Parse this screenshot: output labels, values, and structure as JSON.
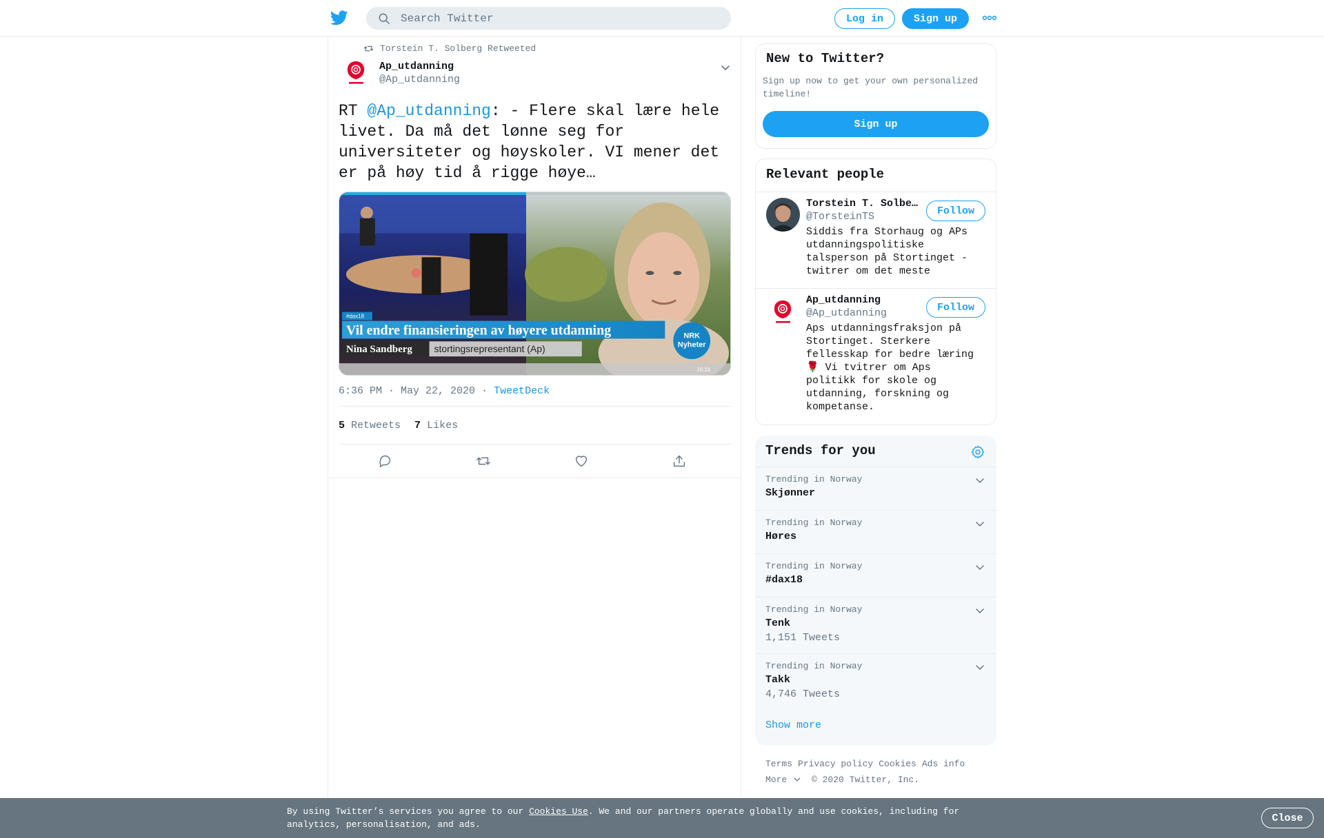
{
  "header": {
    "search_placeholder": "Search Twitter",
    "login_label": "Log in",
    "signup_label": "Sign up"
  },
  "tweet": {
    "retweeted_by": "Torstein T. Solberg Retweeted",
    "author_name": "Ap_utdanning",
    "author_handle": "@Ap_utdanning",
    "text_prefix": "RT ",
    "text_mention": "@Ap_utdanning",
    "text_body": ": - Flere skal lære hele livet. Da må det lønne seg for universiteter og høyskoler. VI mener det er på høy tid å rigge høye…",
    "media": {
      "tag": "#dax18",
      "headline": "Vil endre finansieringen av høyere utdanning",
      "person_name": "Nina Sandberg",
      "person_role": "stortingsrepresentant (Ap)",
      "channel_line1": "NRK",
      "channel_line2": "Nyheter",
      "clock": "16:16"
    },
    "timestamp": "6:36 PM · May 22, 2020",
    "separator": "·",
    "source": "TweetDeck",
    "retweets_count": "5",
    "retweets_label": "Retweets",
    "likes_count": "7",
    "likes_label": "Likes"
  },
  "new_to_twitter": {
    "title": "New to Twitter?",
    "description": "Sign up now to get your own personalized timeline!",
    "signup_label": "Sign up"
  },
  "relevant_people": {
    "title": "Relevant people",
    "people": [
      {
        "name": "Torstein T. Solberg",
        "handle": "@TorsteinTS",
        "bio": "Siddis fra Storhaug og APs utdanningspolitiske talsperson på Stortinget - twitrer om det meste",
        "follow_label": "Follow"
      },
      {
        "name": "Ap_utdanning",
        "handle": "@Ap_utdanning",
        "bio": "Aps utdanningsfraksjon på Stortinget. Sterkere fellesskap for bedre læring 🌹 Vi tvitrer om Aps politikk for skole og utdanning, forskning og kompetanse.",
        "follow_label": "Follow"
      }
    ]
  },
  "trends": {
    "title": "Trends for you",
    "items": [
      {
        "meta": "Trending in Norway",
        "name": "Skjønner",
        "count": ""
      },
      {
        "meta": "Trending in Norway",
        "name": "Høres",
        "count": ""
      },
      {
        "meta": "Trending in Norway",
        "name": "#dax18",
        "count": ""
      },
      {
        "meta": "Trending in Norway",
        "name": "Tenk",
        "count": "1,151 Tweets"
      },
      {
        "meta": "Trending in Norway",
        "name": "Takk",
        "count": "4,746 Tweets"
      }
    ],
    "show_more": "Show more"
  },
  "footer": {
    "links": [
      "Terms",
      "Privacy policy",
      "Cookies",
      "Ads info"
    ],
    "more_label": "More",
    "copyright": "© 2020 Twitter, Inc."
  },
  "cookie_bar": {
    "text_before": "By using Twitter’s services you agree to our ",
    "link": "Cookies Use",
    "text_after": ". We and our partners operate globally and use cookies, including for analytics, personalisation, and ads.",
    "close_label": "Close"
  },
  "colors": {
    "brand": "#1da1f2",
    "link": "#1b95e0",
    "muted": "#657786",
    "cookie_bg": "#66757f"
  }
}
